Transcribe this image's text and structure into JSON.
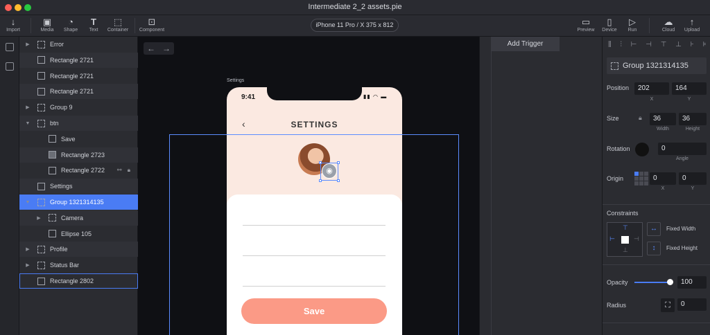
{
  "window": {
    "title": "Intermediate 2_2 assets.pie"
  },
  "toolbar": {
    "import": "Import",
    "media": "Media",
    "shape": "Shape",
    "text": "Text",
    "container": "Container",
    "component": "Component",
    "device": "iPhone 11 Pro / X  375 x 812",
    "preview": "Preview",
    "device_btn": "Device",
    "run": "Run",
    "cloud": "Cloud",
    "upload": "Upload"
  },
  "layers": [
    {
      "name": "Error",
      "icon": "group-icon",
      "arrow": "▶",
      "indent": 0
    },
    {
      "name": "Rectangle 2721",
      "icon": "frame-icon",
      "arrow": "",
      "indent": 0
    },
    {
      "name": "Rectangle 2721",
      "icon": "frame-icon",
      "arrow": "",
      "indent": 0
    },
    {
      "name": "Rectangle 2721",
      "icon": "frame-icon",
      "arrow": "",
      "indent": 0
    },
    {
      "name": "Group 9",
      "icon": "group-icon",
      "arrow": "▶",
      "indent": 0
    },
    {
      "name": "btn",
      "icon": "group-icon",
      "arrow": "▼",
      "indent": 0
    },
    {
      "name": "Save",
      "icon": "frame-icon",
      "arrow": "",
      "indent": 1
    },
    {
      "name": "Rectangle 2723",
      "icon": "rect-icon",
      "arrow": "",
      "indent": 1
    },
    {
      "name": "Rectangle 2722",
      "icon": "frame-icon",
      "arrow": "",
      "indent": 1
    },
    {
      "name": "Settings",
      "icon": "frame-icon",
      "arrow": "",
      "indent": 0
    },
    {
      "name": "Group 1321314135",
      "icon": "group-icon",
      "arrow": "▼",
      "indent": 0
    },
    {
      "name": "Camera",
      "icon": "group-icon",
      "arrow": "▶",
      "indent": 1
    },
    {
      "name": "Ellipse 105",
      "icon": "frame-icon",
      "arrow": "",
      "indent": 1
    },
    {
      "name": "Profile",
      "icon": "group-icon",
      "arrow": "▶",
      "indent": 0
    },
    {
      "name": "Status Bar",
      "icon": "group-icon",
      "arrow": "▶",
      "indent": 0
    },
    {
      "name": "Rectangle 2802",
      "icon": "frame-icon",
      "arrow": "",
      "indent": 0
    }
  ],
  "canvas": {
    "artboard_label": "Settings",
    "time": "9:41",
    "screen_title": "SETTINGS",
    "save_label": "Save",
    "back_icon": "chevron-left-icon"
  },
  "interactions": {
    "add_trigger": "Add Trigger"
  },
  "inspector": {
    "layer_name": "Group 1321314135",
    "position_label": "Position",
    "x": "202",
    "y": "164",
    "x_sub": "X",
    "y_sub": "Y",
    "size_label": "Size",
    "width": "36",
    "height": "36",
    "width_sub": "Width",
    "height_sub": "Height",
    "rotation_label": "Rotation",
    "angle": "0",
    "angle_sub": "Angle",
    "origin_label": "Origin",
    "origin_x": "0",
    "origin_y": "0",
    "origin_x_sub": "X",
    "origin_y_sub": "Y",
    "constraints_label": "Constraints",
    "fixed_width": "Fixed Width",
    "fixed_height": "Fixed Height",
    "opacity_label": "Opacity",
    "opacity": "100",
    "opacity_level": 1.0,
    "radius_label": "Radius",
    "radius": "0"
  },
  "colors": {
    "accent": "#4a7cf4",
    "save_button": "#fb9a86",
    "phone_bg": "#fbe9e1"
  }
}
